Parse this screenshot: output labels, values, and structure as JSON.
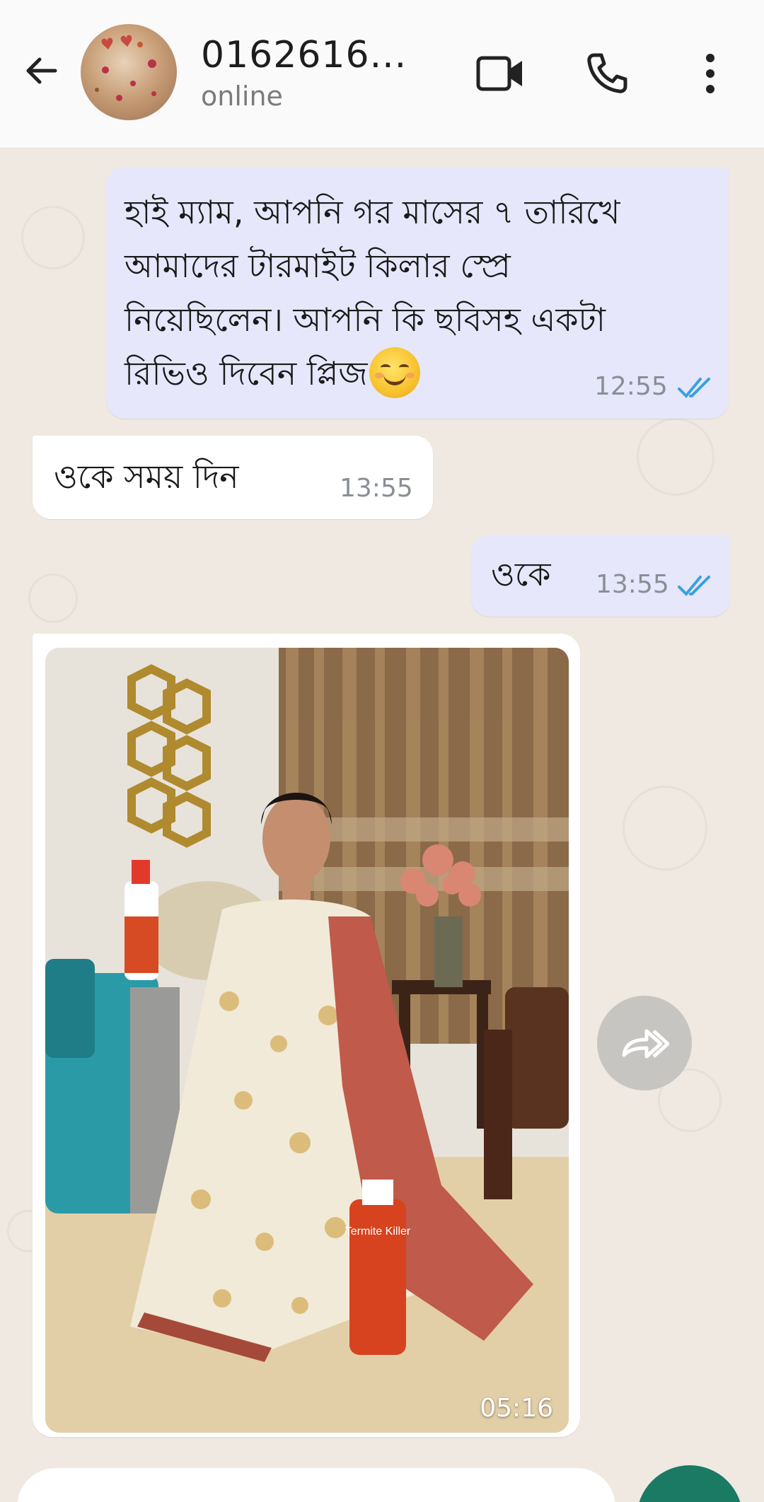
{
  "header": {
    "contact_name": "0162616...",
    "contact_status": "online",
    "icons": [
      "back-arrow-icon",
      "video-call-icon",
      "voice-call-icon",
      "more-options-icon"
    ]
  },
  "messages": [
    {
      "direction": "outgoing",
      "lines": [
        "হাই ম্যাম, আপনি গর মাসের ৭ তারিখে",
        "আমাদের টারমাইট কিলার স্প্রে",
        "নিয়েছিলেন। আপনি কি ছবিসহ একটা",
        "রিভিও দিবেন প্লিজ"
      ],
      "emoji": "smiling-face-emoji",
      "time": "12:55",
      "status": "read"
    },
    {
      "direction": "incoming",
      "text": "ওকে সময় দিন",
      "time": "13:55"
    },
    {
      "direction": "outgoing",
      "text": "ওকে",
      "time": "13:55",
      "status": "read"
    },
    {
      "direction": "incoming",
      "type": "image",
      "time": "05:16",
      "product_label": "Termite Killer"
    }
  ],
  "colors": {
    "outgoing_bubble": "#e6e7fa",
    "incoming_bubble": "#ffffff",
    "read_ticks": "#3aa0e0",
    "accent": "#1b7a63"
  }
}
